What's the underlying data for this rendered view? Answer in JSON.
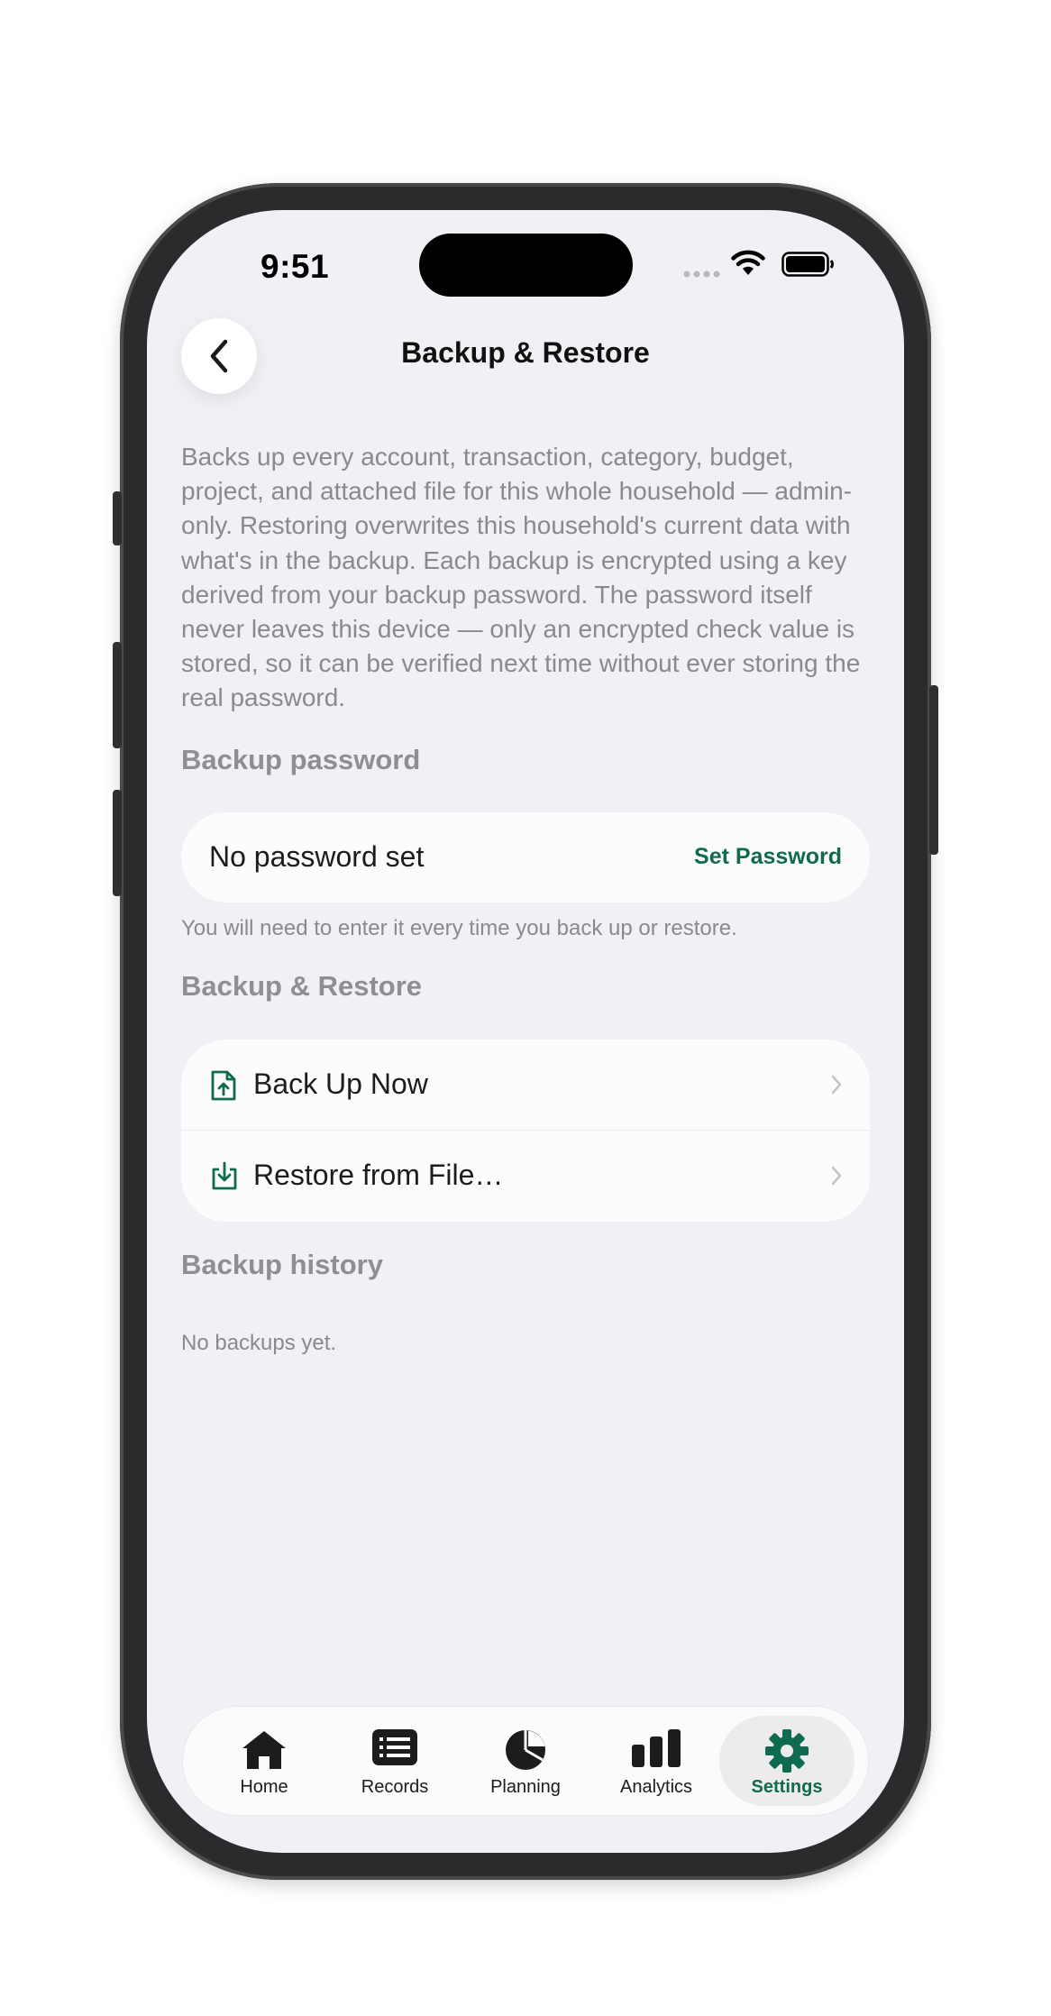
{
  "status_bar": {
    "time": "9:51"
  },
  "header": {
    "title": "Backup & Restore"
  },
  "description": "Backs up every account, transaction, category, budget, project, and attached file for this whole household — admin-only. Restoring overwrites this household's current data with what's in the backup. Each backup is encrypted using a key derived from your backup password. The password itself never leaves this device — only an encrypted check value is stored, so it can be verified next time without ever storing the real password.",
  "password_section": {
    "header": "Backup password",
    "status": "No password set",
    "action": "Set Password",
    "hint": "You will need to enter it every time you back up or restore."
  },
  "backup_section": {
    "header": "Backup & Restore",
    "items": [
      {
        "label": "Back Up Now",
        "icon": "file-upload-icon"
      },
      {
        "label": "Restore from File…",
        "icon": "download-tray-icon"
      }
    ]
  },
  "history_section": {
    "header": "Backup history",
    "empty": "No backups yet."
  },
  "tab_bar": {
    "tabs": [
      {
        "label": "Home",
        "icon": "home-icon"
      },
      {
        "label": "Records",
        "icon": "records-icon"
      },
      {
        "label": "Planning",
        "icon": "pie-chart-icon"
      },
      {
        "label": "Analytics",
        "icon": "bar-chart-icon"
      },
      {
        "label": "Settings",
        "icon": "gear-icon",
        "active": true
      }
    ]
  },
  "colors": {
    "accent": "#0f6b4f",
    "background": "#f0f0f5",
    "card": "#fcfcfc",
    "secondary_text": "#8a8a8e"
  }
}
